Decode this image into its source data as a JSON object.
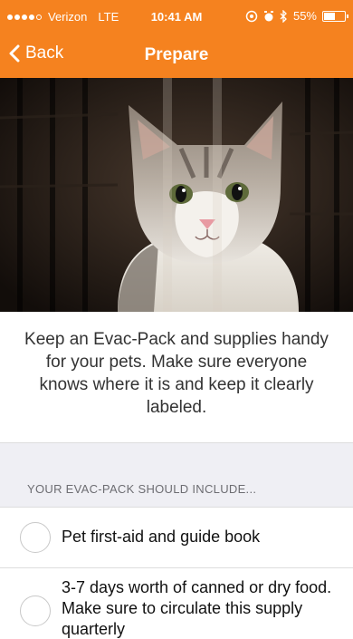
{
  "status_bar": {
    "carrier": "Verizon",
    "network": "LTE",
    "time": "10:41 AM",
    "battery_percent": "55%",
    "battery_level": 0.55
  },
  "nav": {
    "back_label": "Back",
    "title": "Prepare"
  },
  "hero": {
    "image_subject": "kitten in kennel"
  },
  "intro": {
    "text": "Keep an Evac-Pack and supplies handy for your pets. Make sure everyone knows where it is and keep it clearly labeled."
  },
  "section": {
    "header": "YOUR EVAC-PACK SHOULD INCLUDE..."
  },
  "checklist": [
    {
      "label": "Pet first-aid and guide book",
      "checked": false
    },
    {
      "label": "3-7 days worth of canned or dry food. Make sure to circulate this supply quarterly",
      "checked": false
    }
  ],
  "colors": {
    "accent": "#f5821f",
    "section_bg": "#efeff4"
  }
}
